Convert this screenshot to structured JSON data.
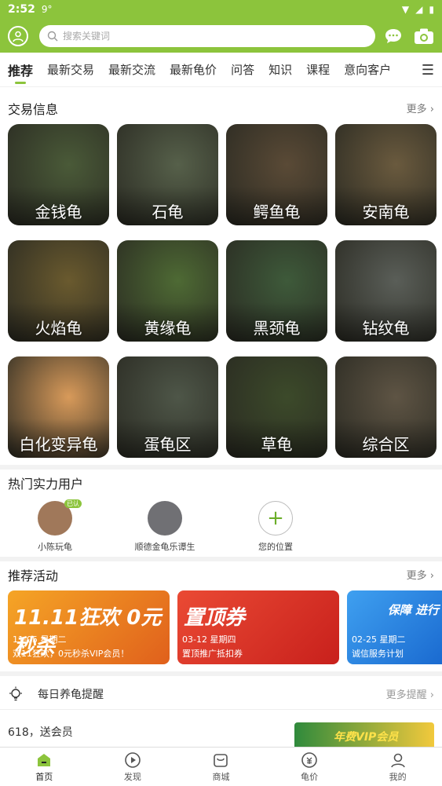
{
  "status": {
    "time": "2:52",
    "signal": "9°"
  },
  "search": {
    "placeholder": "搜索关键词"
  },
  "tabs": [
    {
      "label": "推荐",
      "active": true
    },
    {
      "label": "最新交易"
    },
    {
      "label": "最新交流"
    },
    {
      "label": "最新龟价"
    },
    {
      "label": "问答"
    },
    {
      "label": "知识"
    },
    {
      "label": "课程"
    },
    {
      "label": "意向客户"
    }
  ],
  "trade": {
    "title": "交易信息",
    "more": "更多",
    "tiles": [
      {
        "label": "金钱龟",
        "color": "#4a5a38"
      },
      {
        "label": "石龟",
        "color": "#56604a"
      },
      {
        "label": "鳄鱼龟",
        "color": "#5a4a36"
      },
      {
        "label": "安南龟",
        "color": "#6a5a3e"
      },
      {
        "label": "火焰龟",
        "color": "#6a5a2e"
      },
      {
        "label": "黄缘龟",
        "color": "#4e6a34"
      },
      {
        "label": "黑颈龟",
        "color": "#3e5a3a"
      },
      {
        "label": "钻纹龟",
        "color": "#5a5e58"
      },
      {
        "label": "白化变异龟",
        "color": "#d89a5a"
      },
      {
        "label": "蛋龟区",
        "color": "#4e5648"
      },
      {
        "label": "草龟",
        "color": "#3c4a2a"
      },
      {
        "label": "综合区",
        "color": "#5e5444"
      }
    ]
  },
  "hot_users": {
    "title": "热门实力用户",
    "users": [
      {
        "name": "小陈玩龟",
        "badge": "已认",
        "color": "#a0785a"
      },
      {
        "name": "顺德金龟乐谭生",
        "color": "#707074"
      },
      {
        "name": "您的位置"
      }
    ]
  },
  "activities": {
    "title": "推荐活动",
    "more": "更多",
    "banners": [
      {
        "title": "11.11狂欢 0元秒杀",
        "date": "11-05 星期二",
        "desc": "双11狂欢，0元秒杀VIP会员！",
        "color": "#f08a24"
      },
      {
        "title": "置顶券",
        "date": "03-12 星期四",
        "desc": "置顶推广抵扣券",
        "color": "#e23c2c"
      },
      {
        "title": "保障 进行",
        "date": "02-25 星期二",
        "desc": "诚信服务计划",
        "color": "#2d8ae6"
      }
    ]
  },
  "reminder": {
    "text": "每日养龟提醒",
    "more": "更多提醒"
  },
  "news": {
    "text": "618，送会员",
    "img_text": "年费VIP会员"
  },
  "bottom_nav": [
    {
      "label": "首页",
      "icon": "home-icon",
      "active": true
    },
    {
      "label": "发现",
      "icon": "play-icon"
    },
    {
      "label": "商城",
      "icon": "bag-icon"
    },
    {
      "label": "龟价",
      "icon": "price-icon"
    },
    {
      "label": "我的",
      "icon": "person-icon"
    }
  ]
}
